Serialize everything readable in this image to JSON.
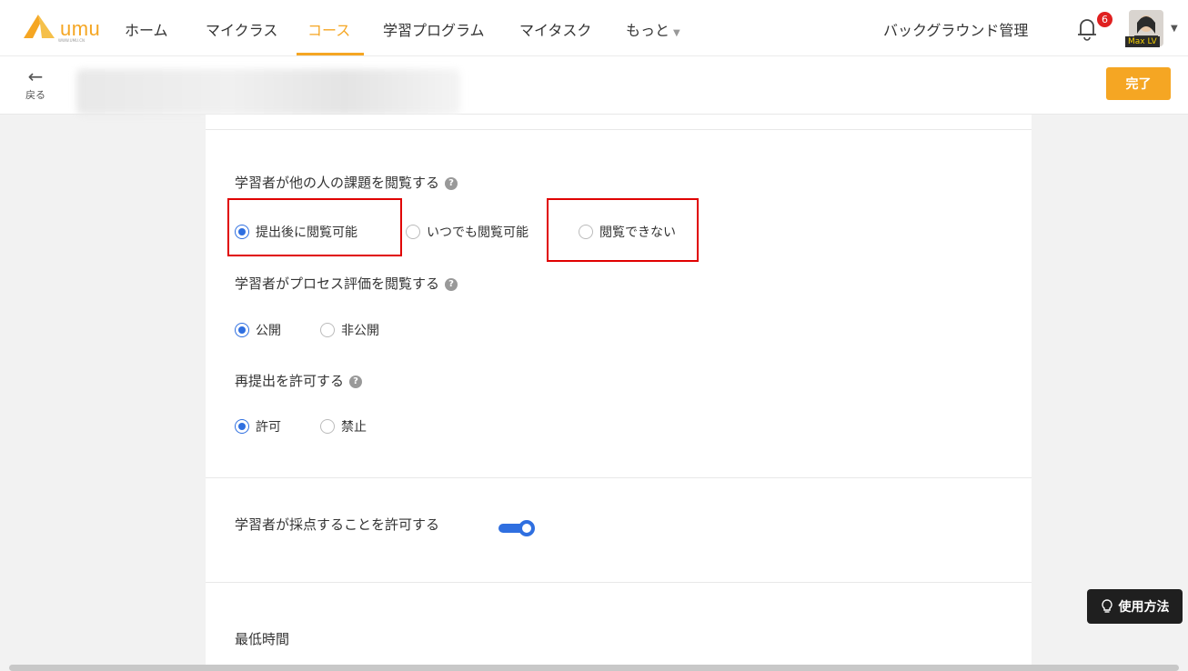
{
  "nav": {
    "logo_text": "umu",
    "logo_sub": "WWW.UMU.CN",
    "items": [
      {
        "label": "ホーム"
      },
      {
        "label": "マイクラス"
      },
      {
        "label": "コース"
      },
      {
        "label": "学習プログラム"
      },
      {
        "label": "マイタスク"
      },
      {
        "label": "もっと"
      }
    ],
    "active": "コース",
    "background_manage": "バックグラウンド管理",
    "notification_count": "6",
    "avatar_tag": "Max LV",
    "accent_color": "#f5a623"
  },
  "subheader": {
    "back_label": "戻る",
    "done_label": "完了"
  },
  "settings": {
    "view_others": {
      "label": "学習者が他の人の課題を閲覧する",
      "options": [
        "提出後に閲覧可能",
        "いつでも閲覧可能",
        "閲覧できない"
      ],
      "selected": "提出後に閲覧可能"
    },
    "process_eval": {
      "label": "学習者がプロセス評価を閲覧する",
      "options": [
        "公開",
        "非公開"
      ],
      "selected": "公開"
    },
    "resubmit": {
      "label": "再提出を許可する",
      "options": [
        "許可",
        "禁止"
      ],
      "selected": "許可"
    },
    "allow_grading": {
      "label": "学習者が採点することを許可する",
      "enabled": true
    },
    "min_time": {
      "label": "最低時間"
    }
  },
  "help_button": {
    "label": "使用方法"
  },
  "colors": {
    "radio_selected": "#2f6fe0",
    "highlight_box": "#e00000"
  }
}
